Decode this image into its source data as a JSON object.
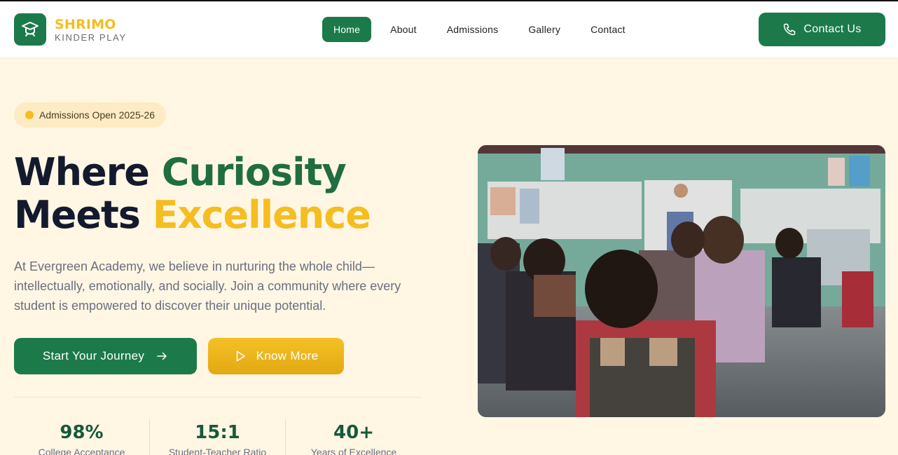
{
  "brand": {
    "name": "SHRIMO",
    "tagline": "KINDER PLAY",
    "icon": "graduation-cap-icon"
  },
  "nav": {
    "items": [
      {
        "label": "Home",
        "active": true
      },
      {
        "label": "About",
        "active": false
      },
      {
        "label": "Admissions",
        "active": false
      },
      {
        "label": "Gallery",
        "active": false
      },
      {
        "label": "Contact",
        "active": false
      }
    ]
  },
  "header": {
    "contact_label": "Contact Us",
    "contact_icon": "phone-icon"
  },
  "hero": {
    "badge": "Admissions Open 2025-26",
    "title_line1_a": "Where ",
    "title_line1_b": "Curiosity",
    "title_line2_a": "Meets ",
    "title_line2_b": "Excellence",
    "description": "At Evergreen Academy, we believe in nurturing the whole child—intellectually, emotionally, and socially. Join a community where every student is empowered to discover their unique potential.",
    "primary_cta": "Start Your Journey",
    "secondary_cta": "Know More",
    "image_subject": "classroom-photo"
  },
  "stats": [
    {
      "value": "98%",
      "label": "College Acceptance"
    },
    {
      "value": "15:1",
      "label": "Student-Teacher Ratio"
    },
    {
      "value": "40+",
      "label": "Years of Excellence"
    }
  ],
  "colors": {
    "primary": "#1c7a4a",
    "accent": "#f5bd1f",
    "background": "#fff6e4",
    "heading": "#141a2e"
  }
}
